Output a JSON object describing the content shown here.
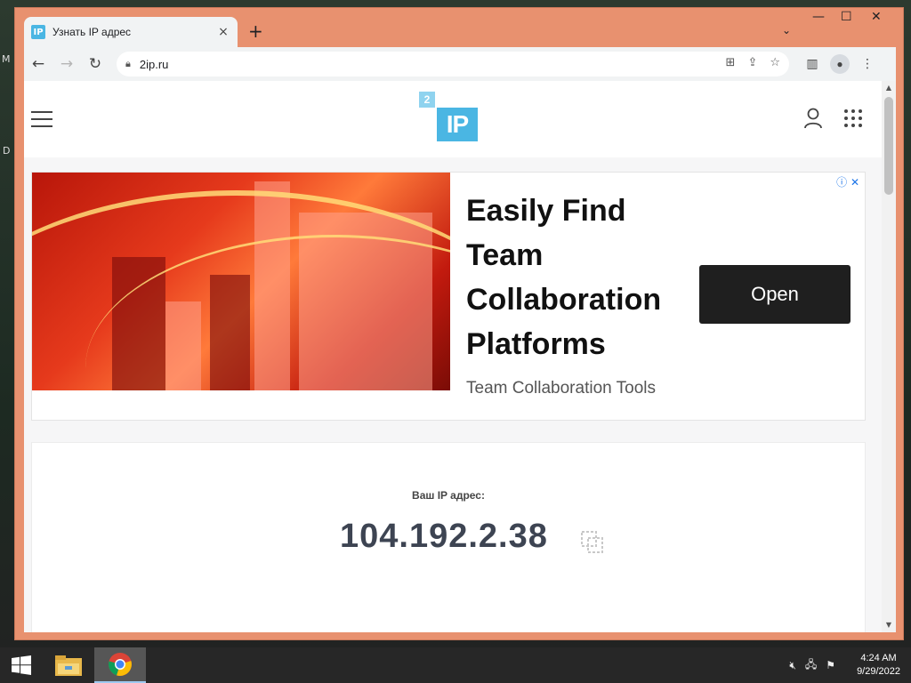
{
  "browser": {
    "tab_title": "Узнать IP адрес",
    "favicon_text": "IP",
    "tab_close": "×",
    "new_tab": "+",
    "tab_search": "⌄",
    "window_controls": {
      "minimize": "—",
      "maximize": "☐",
      "close": "✕"
    },
    "url": "2ip.ru",
    "nav": {
      "back": "←",
      "forward": "→",
      "reload": "↻"
    }
  },
  "site": {
    "logo_small": "2",
    "logo_main": "IP"
  },
  "ad": {
    "headline": "Easily Find Team Collaboration Platforms",
    "subtitle": "Team Collaboration Tools",
    "button_label": "Open",
    "choices": "ⓘ ✕"
  },
  "ip_card": {
    "label": "Ваш IP адрес:",
    "ip": "104.192.2.38"
  },
  "taskbar": {
    "time": "4:24 AM",
    "date": "9/29/2022"
  },
  "desktop": {
    "left_letters": [
      "M",
      "D"
    ]
  },
  "colors": {
    "window_frame": "#e8916f",
    "logo_blue": "#4ab6e3",
    "ad_button": "#1f1f1f",
    "ip_text": "#3d4452"
  }
}
